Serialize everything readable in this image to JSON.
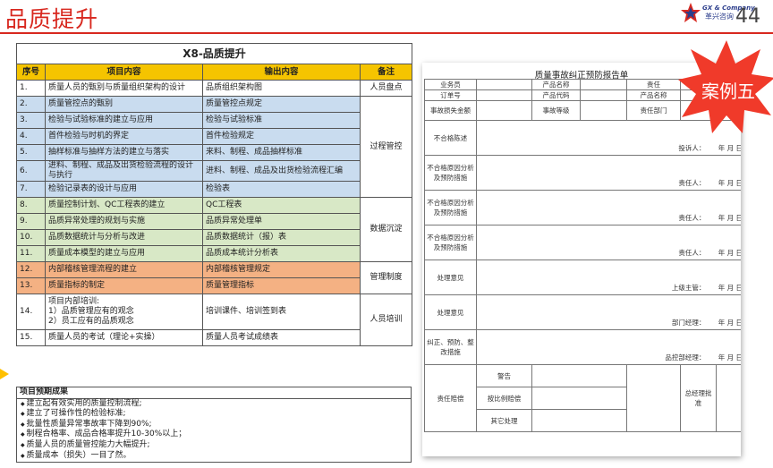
{
  "header": {
    "title": "品质提升",
    "page_number": "44",
    "logo_line1": "GX & Company",
    "logo_line2": "革兴咨询"
  },
  "plan": {
    "table_title": "X8-品质提升",
    "columns": [
      "序号",
      "项目内容",
      "输出内容",
      "备注"
    ],
    "rows": [
      {
        "no": "1.",
        "item": "质量人员的甄别与质量组织架构的设计",
        "output": "品质组织架构图",
        "group": "white"
      },
      {
        "no": "2.",
        "item": "质量管控点的甄别",
        "output": "质量管控点规定",
        "group": "blue"
      },
      {
        "no": "3.",
        "item": "检验与试验标准的建立与应用",
        "output": "检验与试验标准",
        "group": "blue"
      },
      {
        "no": "4.",
        "item": "首件检验与时机的界定",
        "output": "首件检验规定",
        "group": "blue"
      },
      {
        "no": "5.",
        "item": "抽样标准与抽样方法的建立与落实",
        "output": "来料、制程、成品抽样标准",
        "group": "blue"
      },
      {
        "no": "6.",
        "item": "进料、制程、成品及出货检验流程的设计与执行",
        "output": "进料、制程、成品及出货检验流程汇编",
        "group": "blue"
      },
      {
        "no": "7.",
        "item": "检验记录表的设计与应用",
        "output": "检验表",
        "group": "blue"
      },
      {
        "no": "8.",
        "item": "质量控制计划、QC工程表的建立",
        "output": "QC工程表",
        "group": "green"
      },
      {
        "no": "9.",
        "item": "品质异常处理的规划与实施",
        "output": "品质异常处理单",
        "group": "green"
      },
      {
        "no": "10.",
        "item": "品质数据统计与分析与改进",
        "output": "品质数据统计（报）表",
        "group": "green"
      },
      {
        "no": "11.",
        "item": "质量成本模型的建立与应用",
        "output": "品质成本统计分析表",
        "group": "green"
      },
      {
        "no": "12.",
        "item": "内部稽核管理流程的建立",
        "output": "内部稽核管理规定",
        "group": "orange"
      },
      {
        "no": "13.",
        "item": "质量指标的制定",
        "output": "质量管理指标",
        "group": "orange"
      },
      {
        "no": "14.",
        "item": "项目内部培训:\n1）品质管理应有的观念\n2）员工应有的品质观念",
        "output": "培训课件、培训签到表",
        "group": "white2"
      },
      {
        "no": "15.",
        "item": "质量人员的考试（理论+实操）",
        "output": "质量人员考试成绩表",
        "group": "white2"
      }
    ],
    "remarks": [
      "人员盘点",
      "过程管控",
      "数据沉淀",
      "管理制度",
      "人员培训"
    ]
  },
  "outcomes": {
    "heading": "项目预期成果",
    "items": [
      "建立起有效实用的质量控制流程;",
      "建立了可操作性的检验标准;",
      "批量性质量异常事故率下降到90%;",
      "制程合格率、成品合格率提升10-30%以上；",
      "质量人员的质量管控能力大幅提升;",
      "质量成本（损失）一目了然。"
    ]
  },
  "form": {
    "title": "质量事故纠正预防报告单",
    "row1": [
      "业务员",
      "产品名称",
      "责任"
    ],
    "row2": [
      "订单号",
      "产品代码",
      "产品名称"
    ],
    "row3": [
      "事故损失金额",
      "事故等级",
      "责任部门"
    ],
    "nonconform": "不合格陈述",
    "reporter_sig": "投诉人：",
    "cause_label": "不合格原因分析及预防措施",
    "resp_sig": "责任人：",
    "handle": "处理意见",
    "sup_sig": "上级主管：",
    "mgr_sig": "部门经理：",
    "corrective": "纠正、预防、整改措施",
    "qc_sig": "品控部经理：",
    "date": "年  月  日",
    "penalty": "责任赔偿",
    "penalty_opts": [
      "警告",
      "按比例赔偿",
      "其它处理"
    ],
    "gm": "总经理批准"
  },
  "badge": {
    "text": "案例五",
    "color": "#f03a2a"
  }
}
